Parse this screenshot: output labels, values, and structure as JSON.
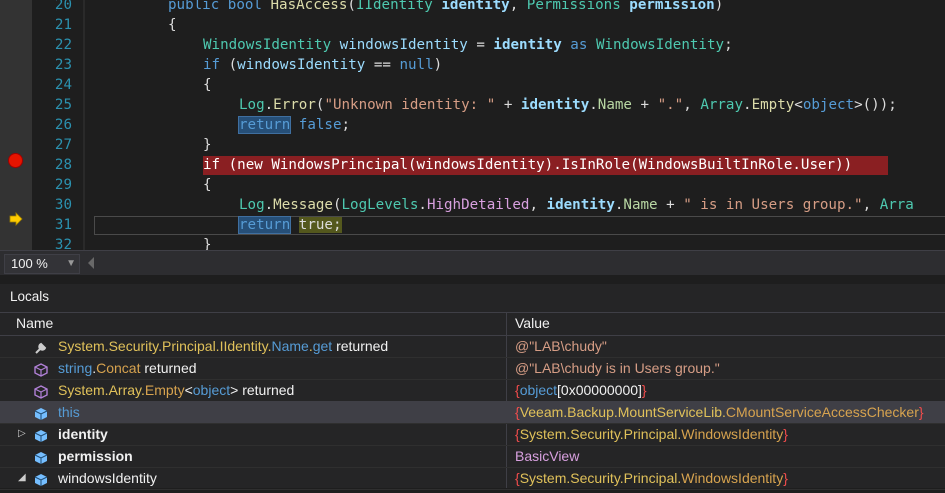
{
  "editor": {
    "lines": [
      {
        "num": "20",
        "tokens": [
          {
            "t": "public ",
            "c": "kw"
          },
          {
            "t": "bool ",
            "c": "kw"
          },
          {
            "t": "HasAccess",
            "c": "mt"
          },
          {
            "t": "(",
            "c": "pu"
          },
          {
            "t": "IIdentity ",
            "c": "ty"
          },
          {
            "t": "identity",
            "c": "pm"
          },
          {
            "t": ", ",
            "c": "pu"
          },
          {
            "t": "Permissions ",
            "c": "ty"
          },
          {
            "t": "permission",
            "c": "pm"
          },
          {
            "t": ")",
            "c": "pu"
          }
        ]
      },
      {
        "num": "21",
        "tokens": [
          {
            "t": "{",
            "c": "pu"
          }
        ]
      },
      {
        "num": "22",
        "tokens": [
          {
            "t": "WindowsIdentity ",
            "c": "ty"
          },
          {
            "t": "windowsIdentity",
            "c": "lc"
          },
          {
            "t": " = ",
            "c": "pu"
          },
          {
            "t": "identity",
            "c": "pm"
          },
          {
            "t": " as ",
            "c": "kw"
          },
          {
            "t": "WindowsIdentity",
            "c": "ty"
          },
          {
            "t": ";",
            "c": "pu"
          }
        ]
      },
      {
        "num": "23",
        "tokens": [
          {
            "t": "if ",
            "c": "kw"
          },
          {
            "t": "(",
            "c": "pu"
          },
          {
            "t": "windowsIdentity",
            "c": "lc"
          },
          {
            "t": " == ",
            "c": "pu"
          },
          {
            "t": "null",
            "c": "kw"
          },
          {
            "t": ")",
            "c": "pu"
          }
        ]
      },
      {
        "num": "24",
        "tokens": [
          {
            "t": "{",
            "c": "pu"
          }
        ]
      },
      {
        "num": "25",
        "tokens": [
          {
            "t": "Log",
            "c": "ty"
          },
          {
            "t": ".",
            "c": "pu"
          },
          {
            "t": "Error",
            "c": "mt"
          },
          {
            "t": "(",
            "c": "pu"
          },
          {
            "t": "\"Unknown identity: \"",
            "c": "st"
          },
          {
            "t": " + ",
            "c": "pu"
          },
          {
            "t": "identity",
            "c": "pm"
          },
          {
            "t": ".",
            "c": "pu"
          },
          {
            "t": "Name",
            "c": "pr"
          },
          {
            "t": " + ",
            "c": "pu"
          },
          {
            "t": "\".\"",
            "c": "st"
          },
          {
            "t": ", ",
            "c": "pu"
          },
          {
            "t": "Array",
            "c": "ty"
          },
          {
            "t": ".",
            "c": "pu"
          },
          {
            "t": "Empty",
            "c": "mt"
          },
          {
            "t": "<",
            "c": "pu"
          },
          {
            "t": "object",
            "c": "kw"
          },
          {
            "t": ">());",
            "c": "pu"
          }
        ]
      },
      {
        "num": "26",
        "tokens": [
          {
            "t": "return",
            "c": "kw",
            "h": "hl-ret"
          },
          {
            "t": " ",
            "c": "pu"
          },
          {
            "t": "false",
            "c": "kw"
          },
          {
            "t": ";",
            "c": "pu"
          }
        ]
      },
      {
        "num": "27",
        "tokens": [
          {
            "t": "}",
            "c": "pu"
          }
        ]
      },
      {
        "num": "28",
        "tokens": [
          {
            "t": "if (new WindowsPrincipal(windowsIdentity).IsInRole(WindowsBuiltInRole.User))",
            "c": "bp"
          }
        ]
      },
      {
        "num": "29",
        "tokens": [
          {
            "t": "{",
            "c": "pu"
          }
        ]
      },
      {
        "num": "30",
        "tokens": [
          {
            "t": "Log",
            "c": "ty"
          },
          {
            "t": ".",
            "c": "pu"
          },
          {
            "t": "Message",
            "c": "mt"
          },
          {
            "t": "(",
            "c": "pu"
          },
          {
            "t": "LogLevels",
            "c": "ty"
          },
          {
            "t": ".",
            "c": "pu"
          },
          {
            "t": "HighDetailed",
            "c": "pp"
          },
          {
            "t": ", ",
            "c": "pu"
          },
          {
            "t": "identity",
            "c": "pm"
          },
          {
            "t": ".",
            "c": "pu"
          },
          {
            "t": "Name",
            "c": "pr"
          },
          {
            "t": " + ",
            "c": "pu"
          },
          {
            "t": "\" is in Users group.\"",
            "c": "st"
          },
          {
            "t": ", ",
            "c": "pu"
          },
          {
            "t": "Arra",
            "c": "ty"
          }
        ]
      },
      {
        "num": "31",
        "tokens": [
          {
            "t": "return",
            "c": "kw",
            "h": "hl-ret"
          },
          {
            "t": " ",
            "c": "pu"
          },
          {
            "t": "true;",
            "c": "pu",
            "h": "hl-cur"
          }
        ]
      },
      {
        "num": "32",
        "tokens": [
          {
            "t": "}",
            "c": "pu"
          }
        ]
      }
    ]
  },
  "zoom": {
    "value": "100 %"
  },
  "locals": {
    "title": "Locals",
    "headers": {
      "name": "Name",
      "value": "Value"
    },
    "rows": [
      {
        "icon": "wrench-icon",
        "expander": "",
        "name": [
          {
            "t": "System.Security.Principal.",
            "c": "y"
          },
          {
            "t": "IIdentity.",
            "c": "y"
          },
          {
            "t": "Name",
            "c": "b"
          },
          {
            "t": ".",
            "c": "y"
          },
          {
            "t": "get",
            "c": "b"
          },
          {
            "t": " returned",
            "c": "w"
          }
        ],
        "value": [
          {
            "t": "@\"LAB\\chudy\"",
            "c": "sv"
          }
        ]
      },
      {
        "icon": "method-cube-icon",
        "expander": "",
        "name": [
          {
            "t": "string",
            "c": "b"
          },
          {
            "t": ".",
            "c": "w"
          },
          {
            "t": "Concat",
            "c": "o"
          },
          {
            "t": " returned",
            "c": "w"
          }
        ],
        "value": [
          {
            "t": "@\"LAB\\chudy is in Users group.\"",
            "c": "sv"
          }
        ]
      },
      {
        "icon": "method-cube-icon",
        "expander": "",
        "name": [
          {
            "t": "System.",
            "c": "y"
          },
          {
            "t": "Array.",
            "c": "y"
          },
          {
            "t": "Empty",
            "c": "o"
          },
          {
            "t": "<",
            "c": "w"
          },
          {
            "t": "object",
            "c": "b"
          },
          {
            "t": "> returned",
            "c": "w"
          }
        ],
        "value": [
          {
            "t": "{",
            "c": "r"
          },
          {
            "t": "object",
            "c": "b"
          },
          {
            "t": "[0x00000000]",
            "c": "w"
          },
          {
            "t": "}",
            "c": "r"
          }
        ]
      },
      {
        "icon": "variable-icon",
        "expander": "",
        "selected": true,
        "name": [
          {
            "t": "this",
            "c": "b"
          }
        ],
        "value": [
          {
            "t": "{",
            "c": "r"
          },
          {
            "t": "Veeam.Backup.MountServiceLib.",
            "c": "y"
          },
          {
            "t": "CMountServiceAccessChecker",
            "c": "o"
          },
          {
            "t": "}",
            "c": "r"
          }
        ]
      },
      {
        "icon": "variable-icon",
        "expander": "▷",
        "name": [
          {
            "t": "identity",
            "c": "w",
            "bold": true
          }
        ],
        "value": [
          {
            "t": "{",
            "c": "r"
          },
          {
            "t": "System.Security.Principal.",
            "c": "y"
          },
          {
            "t": "WindowsIdentity",
            "c": "o"
          },
          {
            "t": "}",
            "c": "r"
          }
        ]
      },
      {
        "icon": "variable-icon",
        "expander": "",
        "name": [
          {
            "t": "permission",
            "c": "w",
            "bold": true
          }
        ],
        "value": [
          {
            "t": "BasicView",
            "c": "pv"
          }
        ]
      },
      {
        "icon": "variable-icon",
        "expander": "◢",
        "name": [
          {
            "t": "windowsIdentity",
            "c": "w"
          }
        ],
        "value": [
          {
            "t": "{",
            "c": "r"
          },
          {
            "t": "System.Security.Principal.",
            "c": "y"
          },
          {
            "t": "WindowsIdentity",
            "c": "o"
          },
          {
            "t": "}",
            "c": "r"
          }
        ]
      }
    ]
  }
}
